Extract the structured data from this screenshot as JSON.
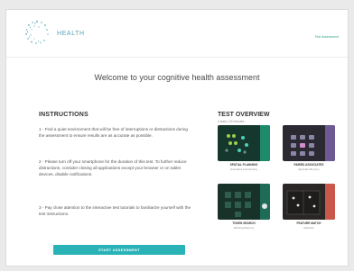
{
  "header": {
    "brand": "HEALTH",
    "link": "Test Assessment"
  },
  "page": {
    "title": "Welcome to your cognitive health assessment"
  },
  "instructions": {
    "heading": "INSTRUCTIONS",
    "items": [
      "1 - Find a quiet environment that will be free of interruptions or distractions during the assessment to ensure results are as accurate as possible.",
      "2 - Please turn off your smartphone for the duration of this test. To further reduce distractions, consider closing all applications except your browser or on tablet devices, disable notifications.",
      "3 - Pay close attention to the interactive test tutorials to familiarize yourself with the test instructions."
    ],
    "start_button": "START ASSESSMENT"
  },
  "overview": {
    "heading": "TEST OVERVIEW",
    "subtitle": "4 tests | 15 minutes",
    "tests": [
      {
        "name": "SPATIAL PLANNING",
        "desc": "Executive Functioning",
        "bg": "#16372e",
        "side": "#1f8a6a"
      },
      {
        "name": "PAIRED ASSOCIATES",
        "desc": "Episodic Memory",
        "bg": "#2b2a33",
        "side": "#6e5a93"
      },
      {
        "name": "TOKEN SEARCH",
        "desc": "Working Memory",
        "bg": "#183229",
        "side": "#1e6b58"
      },
      {
        "name": "FEATURE MATCH",
        "desc": "Attention",
        "bg": "#2a2626",
        "side": "#c9584a"
      }
    ]
  },
  "colors": {
    "accent": "#2ab3b7",
    "brand": "#5aa2b8"
  }
}
